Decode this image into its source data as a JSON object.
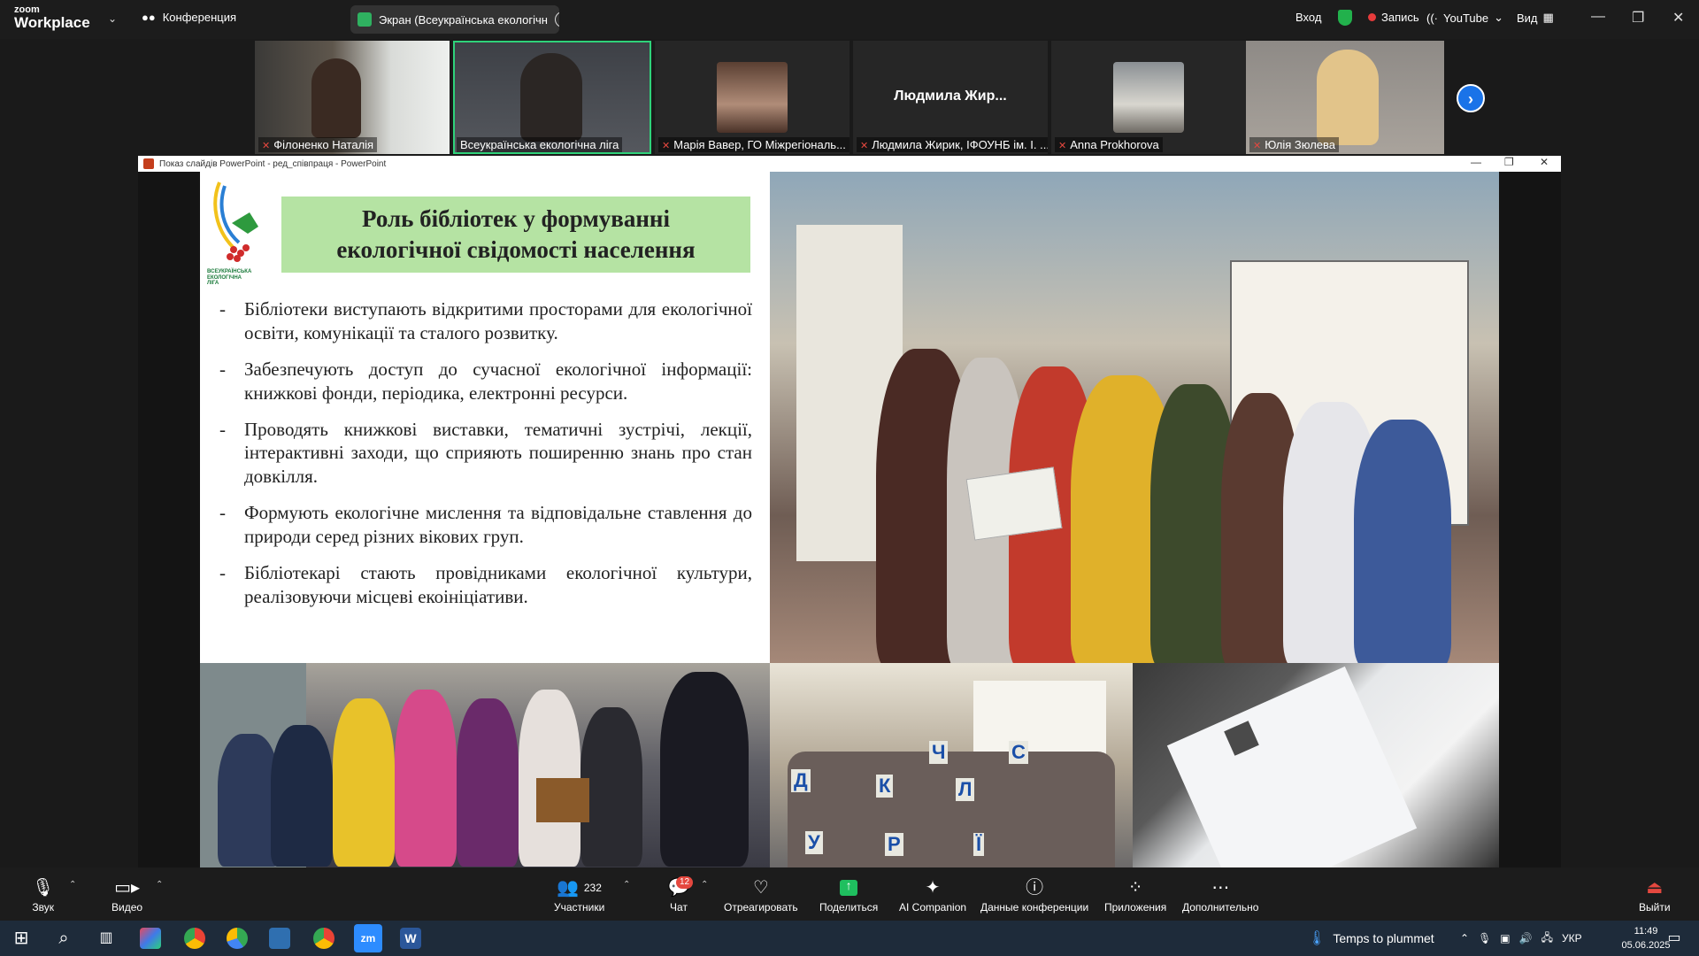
{
  "topbar": {
    "logo_small": "zoom",
    "logo_big": "Workplace",
    "conference_label": "Конференция",
    "screen_share_label": "Экран (Всеукраїнська екологічн",
    "signin": "Вход",
    "record": "Запись",
    "youtube": "YouTube",
    "view": "Вид"
  },
  "participants": [
    {
      "name": "Філоненко Наталія"
    },
    {
      "name": "Всеукраїнська екологічна ліга"
    },
    {
      "name": "Марія Вавер, ГО Міжрегіональ..."
    },
    {
      "name": "Людмила Жирик, ІФОУНБ ім. І. ...",
      "display": "Людмила Жир..."
    },
    {
      "name": "Anna Prokhorova"
    },
    {
      "name": "Юлія Зюлева"
    }
  ],
  "powerpoint": {
    "window_title": "Показ слайдів PowerPoint  -  ред_співпраця  -  PowerPoint"
  },
  "slide": {
    "title_line1": "Роль бібліотек у формуванні",
    "title_line2": "екологічної свідомості населення",
    "logo_text_line1": "ВСЕУКРАЇНСЬКА",
    "logo_text_line2": "ЕКОЛОГІЧНА",
    "logo_text_line3": "ЛІГА",
    "bullets": [
      "Бібліотеки виступають відкритими просторами для екологічної освіти, комунікації та сталого розвитку.",
      "Забезпечують доступ до сучасної екологічної інформації: книжкові фонди, періодика, електронні ресурси.",
      "Проводять книжкові виставки, тематичні зустрічі, лекції, інтерактивні заходи, що сприяють поширенню знань про стан довкілля.",
      "Формують екологічне мислення та відповідальне ставлення до природи серед різних вікових груп.",
      "Бібліотекарі стають провідниками екологічної культури, реалізовуючи місцеві екоініціативи."
    ],
    "bullet_dash": "-"
  },
  "toolbar": {
    "audio": "Звук",
    "video": "Видео",
    "participants": "Участники",
    "participants_count": "232",
    "chat": "Чат",
    "chat_badge": "12",
    "react": "Отреагировать",
    "share": "Поделиться",
    "ai": "AI Companion",
    "info": "Данные конференции",
    "apps": "Приложения",
    "more": "Дополнительно",
    "leave": "Выйти"
  },
  "taskbar": {
    "weather": "Temps to plummet",
    "lang": "УКР",
    "time": "11:49",
    "date": "05.06.2025"
  }
}
